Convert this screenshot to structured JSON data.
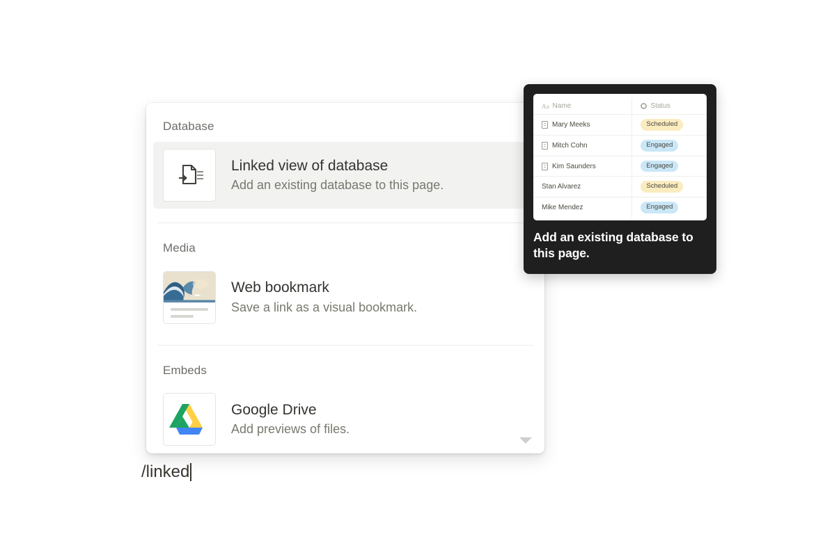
{
  "editor": {
    "typed_command": "/linked"
  },
  "menu": {
    "sections": [
      {
        "label": "Database",
        "items": [
          {
            "title": "Linked view of database",
            "description": "Add an existing database to this page.",
            "icon": "linked-database-icon",
            "selected": true
          }
        ]
      },
      {
        "label": "Media",
        "items": [
          {
            "title": "Web bookmark",
            "description": "Save a link as a visual bookmark.",
            "icon": "web-bookmark-icon",
            "selected": false
          }
        ]
      },
      {
        "label": "Embeds",
        "items": [
          {
            "title": "Google Drive",
            "description": "Add previews of files.",
            "icon": "google-drive-icon",
            "selected": false
          }
        ]
      }
    ],
    "scroll_indicator": "chevron-down-icon"
  },
  "tooltip": {
    "caption": "Add an existing database to this page.",
    "preview": {
      "columns": [
        {
          "label": "Name",
          "icon": "title-property-icon"
        },
        {
          "label": "Status",
          "icon": "select-property-icon"
        }
      ],
      "rows": [
        {
          "name": "Mary Meeks",
          "has_page_icon": true,
          "status": "Scheduled",
          "status_color": "#fbecbf"
        },
        {
          "name": "Mitch Cohn",
          "has_page_icon": true,
          "status": "Engaged",
          "status_color": "#c9e7f7"
        },
        {
          "name": "Kim Saunders",
          "has_page_icon": true,
          "status": "Engaged",
          "status_color": "#c9e7f7"
        },
        {
          "name": "Stan Alvarez",
          "has_page_icon": false,
          "status": "Scheduled",
          "status_color": "#fbecbf"
        },
        {
          "name": "Mike Mendez",
          "has_page_icon": false,
          "status": "Engaged",
          "status_color": "#c9e7f7"
        }
      ]
    }
  },
  "colors": {
    "tooltip_bg": "#1f1f1f",
    "selected_row_bg": "#f2f2f1",
    "status_scheduled": "#fbecbf",
    "status_engaged": "#c9e7f7",
    "drive_green": "#1da462",
    "drive_yellow": "#ffcf45",
    "drive_blue": "#4285f4"
  }
}
